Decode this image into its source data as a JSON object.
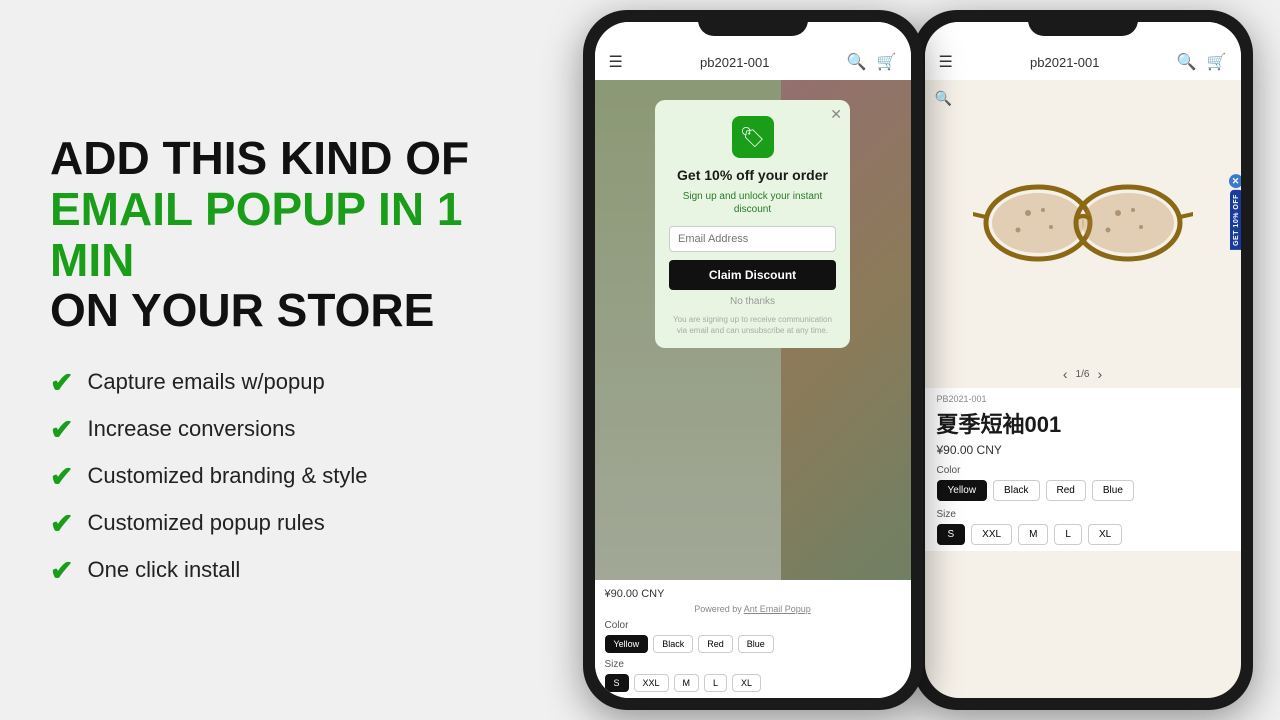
{
  "left": {
    "headline": {
      "line1": "ADD THIS KIND OF",
      "line2": "EMAIL POPUP",
      "line2b": " IN 1 MIN",
      "line3": "ON YOUR STORE"
    },
    "features": [
      "Capture emails w/popup",
      "Increase conversions",
      "Customized branding & style",
      "Customized popup rules",
      "One click install"
    ]
  },
  "phone1": {
    "topbar_title": "pb2021-001",
    "popup": {
      "title": "Get 10% off your order",
      "subtitle": "Sign up and unlock your instant discount",
      "email_placeholder": "Email Address",
      "cta_button": "Claim Discount",
      "no_thanks": "No thanks",
      "disclaimer": "You are signing up to receive communication via email and can unsubscribe at any time."
    },
    "product": {
      "price": "¥90.00 CNY",
      "powered_by": "Powered by",
      "powered_link": "Ant Email Popup",
      "color_label": "Color",
      "colors": [
        "Yellow",
        "Black",
        "Red",
        "Blue"
      ],
      "active_color": "Yellow",
      "size_label": "Size",
      "sizes": [
        "S",
        "XXL",
        "M",
        "L",
        "XL"
      ],
      "active_size": "S"
    }
  },
  "phone2": {
    "topbar_title": "pb2021-001",
    "product": {
      "sku": "PB2021-001",
      "name": "夏季短袖001",
      "price": "¥90.00 CNY",
      "color_label": "Color",
      "colors": [
        "Yellow",
        "Black",
        "Red",
        "Blue"
      ],
      "active_color": "Yellow",
      "size_label": "Size",
      "sizes": [
        "S",
        "XXL",
        "M",
        "L",
        "XL"
      ],
      "active_size": "S",
      "slide_indicator": "1/6",
      "badge_text": "GET 10% OFF"
    }
  }
}
